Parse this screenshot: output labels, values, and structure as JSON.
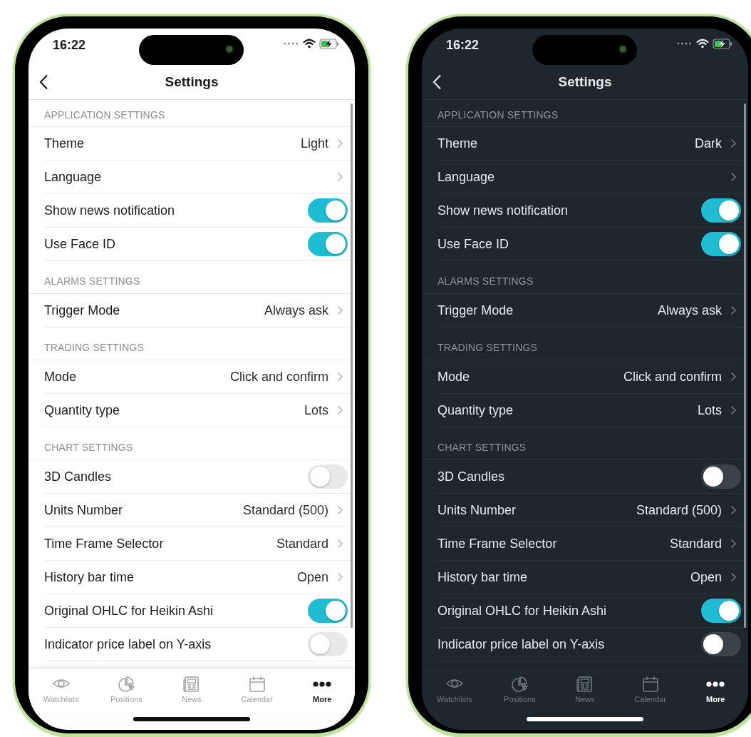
{
  "phones": [
    {
      "dark": false,
      "time": "16:22",
      "title": "Settings",
      "sections": [
        {
          "header": "APPLICATION SETTINGS",
          "rows": [
            {
              "kind": "value",
              "label": "Theme",
              "value": "Light"
            },
            {
              "kind": "value",
              "label": "Language"
            },
            {
              "kind": "switch",
              "label": "Show news notification",
              "on": true
            },
            {
              "kind": "switch",
              "label": "Use Face ID",
              "on": true
            }
          ]
        },
        {
          "header": "ALARMS SETTINGS",
          "rows": [
            {
              "kind": "value",
              "label": "Trigger Mode",
              "value": "Always ask"
            }
          ]
        },
        {
          "header": "TRADING SETTINGS",
          "rows": [
            {
              "kind": "value",
              "label": "Mode",
              "value": "Click and confirm"
            },
            {
              "kind": "value",
              "label": "Quantity type",
              "value": "Lots"
            }
          ]
        },
        {
          "header": "CHART SETTINGS",
          "rows": [
            {
              "kind": "switch",
              "label": "3D Candles",
              "on": false
            },
            {
              "kind": "value",
              "label": "Units Number",
              "value": "Standard (500)"
            },
            {
              "kind": "value",
              "label": "Time Frame Selector",
              "value": "Standard"
            },
            {
              "kind": "value",
              "label": "History bar time",
              "value": "Open"
            },
            {
              "kind": "switch",
              "label": "Original OHLC for Heikin Ashi",
              "on": true
            },
            {
              "kind": "switch",
              "label": "Indicator price label on Y-axis",
              "on": false
            }
          ]
        }
      ],
      "tabs": [
        {
          "label": "Watchlists",
          "selected": false
        },
        {
          "label": "Positions",
          "selected": false
        },
        {
          "label": "News",
          "selected": false
        },
        {
          "label": "Calendar",
          "selected": false
        },
        {
          "label": "More",
          "selected": true
        }
      ]
    },
    {
      "dark": true,
      "time": "16:22",
      "title": "Settings",
      "sections": [
        {
          "header": "APPLICATION SETTINGS",
          "rows": [
            {
              "kind": "value",
              "label": "Theme",
              "value": "Dark"
            },
            {
              "kind": "value",
              "label": "Language"
            },
            {
              "kind": "switch",
              "label": "Show news notification",
              "on": true
            },
            {
              "kind": "switch",
              "label": "Use Face ID",
              "on": true
            }
          ]
        },
        {
          "header": "ALARMS SETTINGS",
          "rows": [
            {
              "kind": "value",
              "label": "Trigger Mode",
              "value": "Always ask"
            }
          ]
        },
        {
          "header": "TRADING SETTINGS",
          "rows": [
            {
              "kind": "value",
              "label": "Mode",
              "value": "Click and confirm"
            },
            {
              "kind": "value",
              "label": "Quantity type",
              "value": "Lots"
            }
          ]
        },
        {
          "header": "CHART SETTINGS",
          "rows": [
            {
              "kind": "switch",
              "label": "3D Candles",
              "on": false
            },
            {
              "kind": "value",
              "label": "Units Number",
              "value": "Standard (500)"
            },
            {
              "kind": "value",
              "label": "Time Frame Selector",
              "value": "Standard"
            },
            {
              "kind": "value",
              "label": "History bar time",
              "value": "Open"
            },
            {
              "kind": "switch",
              "label": "Original OHLC for Heikin Ashi",
              "on": true
            },
            {
              "kind": "switch",
              "label": "Indicator price label on Y-axis",
              "on": false
            }
          ]
        }
      ],
      "tabs": [
        {
          "label": "Watchlists",
          "selected": false
        },
        {
          "label": "Positions",
          "selected": false
        },
        {
          "label": "News",
          "selected": false
        },
        {
          "label": "Calendar",
          "selected": false
        },
        {
          "label": "More",
          "selected": true
        }
      ]
    }
  ]
}
